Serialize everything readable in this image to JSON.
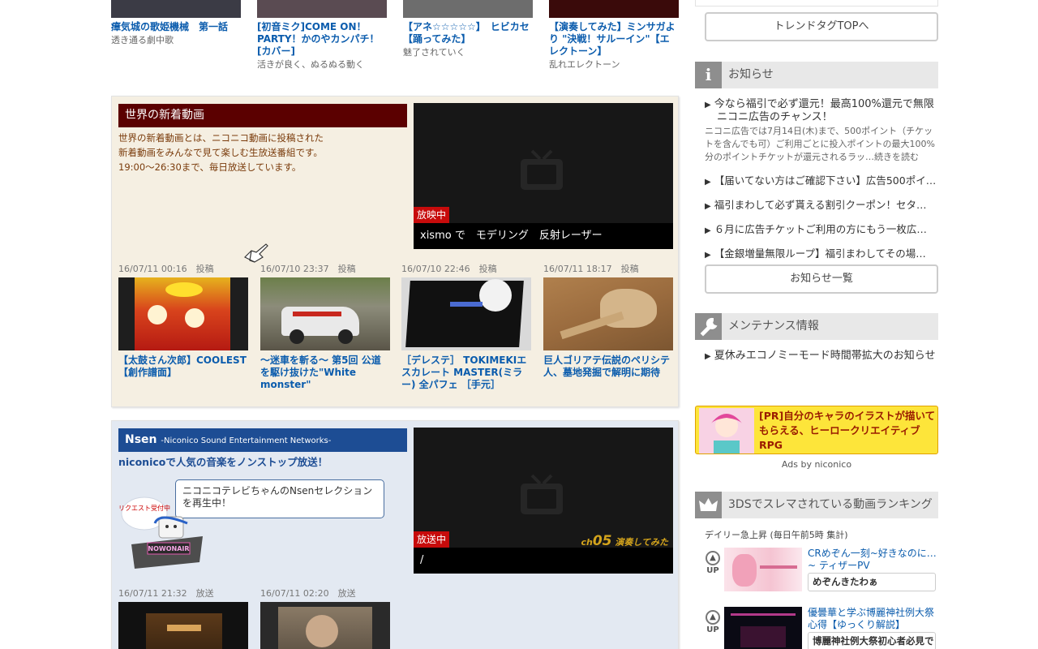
{
  "top_videos": [
    {
      "title": "瘴気城の歌姫機械　第一話",
      "subtitle": "透き通る劇中歌"
    },
    {
      "title": "[初音ミク]COME ON！PARTY！かのやカンパチ！[カバー]",
      "subtitle": "活きが良く、ぬるぬる動く"
    },
    {
      "title": "【アネ☆☆☆☆☆】　ヒビカセ　【踊ってみた】",
      "subtitle": "魅了されていく"
    },
    {
      "title": "【演奏してみた】ミンサガより \"決戦！サルーイン\"【エレクトーン】",
      "subtitle": "乱れエレクトーン"
    }
  ],
  "new_videos_panel": {
    "heading": "世界の新着動画",
    "description": [
      "世界の新着動画とは、ニコニコ動画に投稿された",
      "新着動画をみんなで見て楽しむ生放送番組です。",
      "19:00〜26:30まで、毎日放送しています。"
    ],
    "player": {
      "status": "放映中",
      "caption": "xismo で　モデリング　反射レーザー"
    },
    "videos": [
      {
        "date": "16/07/11 00:16",
        "label": "投稿",
        "title": "【太鼓さん次郎】COOLEST【創作譜面】"
      },
      {
        "date": "16/07/10 23:37",
        "label": "投稿",
        "title": "～迷車を斬る～ 第5回 公道を駆け抜けた\"White monster\""
      },
      {
        "date": "16/07/10 22:46",
        "label": "投稿",
        "title": "［デレステ］ TOKIMEKIエスカレート MASTER(ミラー) 全パフェ ［手元］"
      },
      {
        "date": "16/07/11 18:17",
        "label": "投稿",
        "title": "巨人ゴリアテ伝説のペリシテ人、墓地発掘で解明に期待"
      }
    ]
  },
  "nsen_panel": {
    "heading": "Nsen",
    "heading_sub": "-Niconico Sound Entertainment Networks-",
    "tagline": "niconicoで人気の音楽をノンストップ放送！",
    "bubble": "ニコニコテレビちゃんのNsenセレクションを再生中！",
    "mascot_label": "リクエスト受付中",
    "mascot_sign": "NOWONAIR",
    "player": {
      "status": "放送中",
      "caption": "/",
      "channel_prefix": "ch",
      "channel_num": "05",
      "channel_name": "演奏してみた"
    },
    "videos": [
      {
        "date": "16/07/11 21:32",
        "label": "放送"
      },
      {
        "date": "16/07/11 02:20",
        "label": "放送"
      }
    ]
  },
  "sidebar": {
    "trend_button": "トレンドタグTOPへ",
    "notice": {
      "heading": "お知らせ",
      "main_title": "今なら福引で必ず還元！最高100%還元で無限ニコニ広告のチャンス！",
      "main_detail": "ニコニ広告では7月14日(木)まで、500ポイント（チケットを含んでも可）ご利用ごとに投入ポイントの最大100%分のポイントチケットが還元されるラッ…続きを読む",
      "items": [
        "【届いてない方はご確認下さい】広告500ポイ…",
        "福引まわして必ず貰える割引クーポン！セタ…",
        "６月に広告チケットご利用の方にもう一枚広…",
        "【金銀増量無限ループ】福引まわしてその場…"
      ],
      "list_button": "お知らせ一覧"
    },
    "maintenance": {
      "heading": "メンテナンス情報",
      "items": [
        "夏休みエコノミーモード時間帯拡大のお知らせ"
      ]
    },
    "ad": {
      "text": "[PR]自分のキャラのイラストが描いてもらえる、ヒーロークリエイティブRPG",
      "by": "Ads by niconico"
    },
    "ranking": {
      "heading": "3DSでスレマされている動画ランキング",
      "subtitle": "デイリー急上昇 (毎日午前5時 集計)",
      "items": [
        {
          "badge": "UP",
          "title": "CRめぞん一刻~好きなのに…~ ティザーPV",
          "channel": "めぞんきたわぁ"
        },
        {
          "badge": "UP",
          "title": "優曇華と学ぶ博麗神社例大祭心得【ゆっくり解説】",
          "channel": "博麗神社例大祭初心者必見で"
        }
      ]
    }
  },
  "icons": [
    "tv-icon",
    "info-icon",
    "wrench-icon",
    "crown-icon",
    "arrow-up-icon",
    "pointer-cursor-icon"
  ]
}
